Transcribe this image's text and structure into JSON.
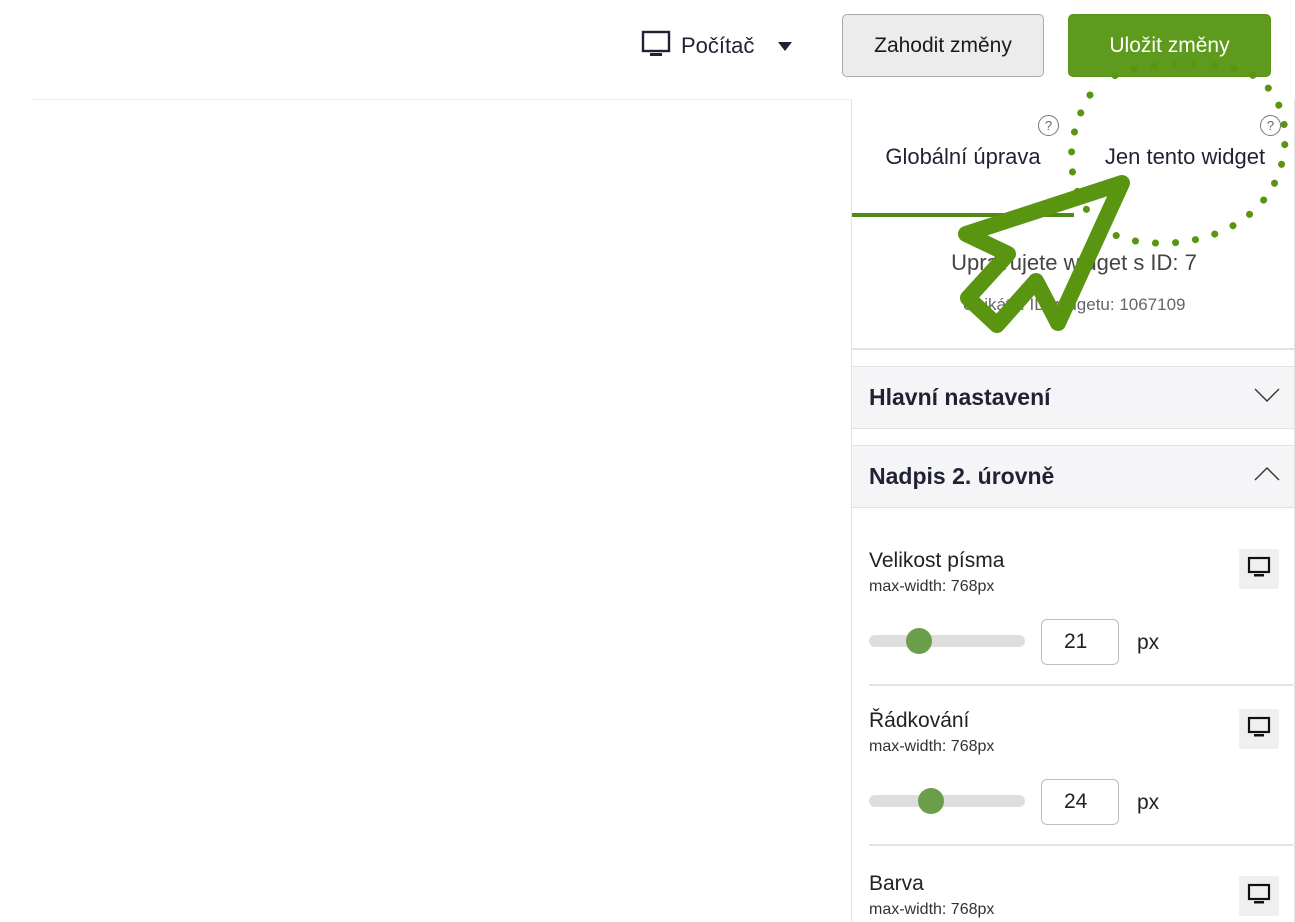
{
  "toolbar": {
    "device_label": "Počítač",
    "discard_label": "Zahodit změny",
    "save_label": "Uložit změny"
  },
  "panel": {
    "tabs": [
      {
        "label": "Globální úprava",
        "active": true,
        "help": "?"
      },
      {
        "label": "Jen tento widget",
        "active": false,
        "help": "?"
      }
    ],
    "editing_title": "Upravujete widget s ID: 7",
    "editing_sub": "Unikátní ID widgetu: 1067109",
    "sections": [
      {
        "title": "Hlavní nastavení",
        "expanded": false
      },
      {
        "title": "Nadpis 2. úrovně",
        "expanded": true
      }
    ],
    "settings": [
      {
        "name": "Velikost písma",
        "sub": "max-width: 768px",
        "value": "21",
        "unit": "px",
        "slider_fraction": 0.32
      },
      {
        "name": "Řádkování",
        "sub": "max-width: 768px",
        "value": "24",
        "unit": "px",
        "slider_fraction": 0.4
      },
      {
        "name": "Barva",
        "sub": "max-width: 768px"
      }
    ]
  },
  "colors": {
    "accent": "#5e9a1d",
    "tab_underline": "#4f8a17",
    "slider_knob": "#6a9e48",
    "annotation": "#5a9512"
  },
  "icons": {
    "device": "monitor-icon",
    "caret": "caret-down-icon",
    "help": "help-circle-icon",
    "collapsed": "chevron-down-icon",
    "expanded": "chevron-up-icon"
  }
}
